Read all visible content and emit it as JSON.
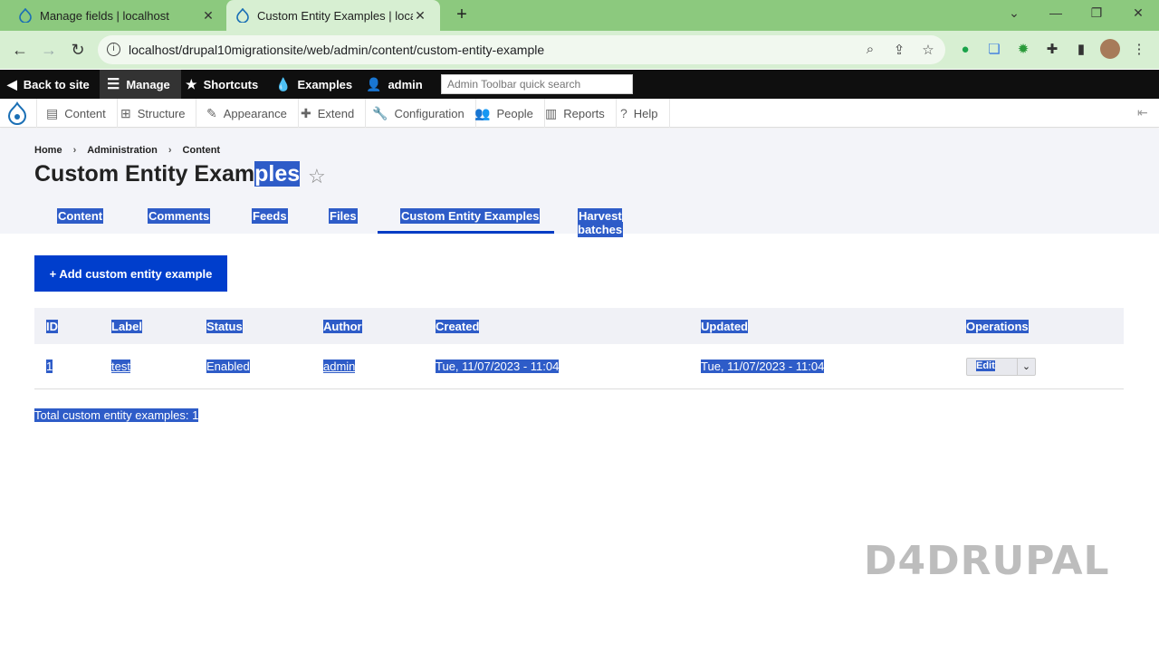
{
  "browser": {
    "tabs": [
      {
        "title": "Manage fields | localhost",
        "active": false
      },
      {
        "title": "Custom Entity Examples | localhost",
        "active": true
      }
    ],
    "url": "localhost/drupal10migrationsite/web/admin/content/custom-entity-example"
  },
  "toolbar": {
    "back": "Back to site",
    "manage": "Manage",
    "shortcuts": "Shortcuts",
    "examples": "Examples",
    "user": "admin",
    "search_placeholder": "Admin Toolbar quick search"
  },
  "tray": [
    "Content",
    "Structure",
    "Appearance",
    "Extend",
    "Configuration",
    "People",
    "Reports",
    "Help"
  ],
  "breadcrumb": [
    "Home",
    "Administration",
    "Content"
  ],
  "page_title_plain": "Custom Entity Exam",
  "page_title_selected": "ples",
  "tabs": [
    "Content",
    "Comments",
    "Feeds",
    "Files",
    "Custom Entity Examples",
    "Harvest batches"
  ],
  "add_button": "+ Add custom entity example",
  "table": {
    "headers": [
      "ID",
      "Label",
      "Status",
      "Author",
      "Created",
      "Updated",
      "Operations"
    ],
    "rows": [
      {
        "id": "1",
        "label": "test",
        "status": "Enabled",
        "author": "admin",
        "created": "Tue, 11/07/2023 - 11:04",
        "updated": "Tue, 11/07/2023 - 11:04",
        "op": "Edit"
      }
    ]
  },
  "total": "Total custom entity examples: 1",
  "watermark": "D4DRUPAL",
  "colors": {
    "accent": "#003ecc",
    "selection": "#2e5cc8",
    "chrome": "#8cc97e"
  }
}
